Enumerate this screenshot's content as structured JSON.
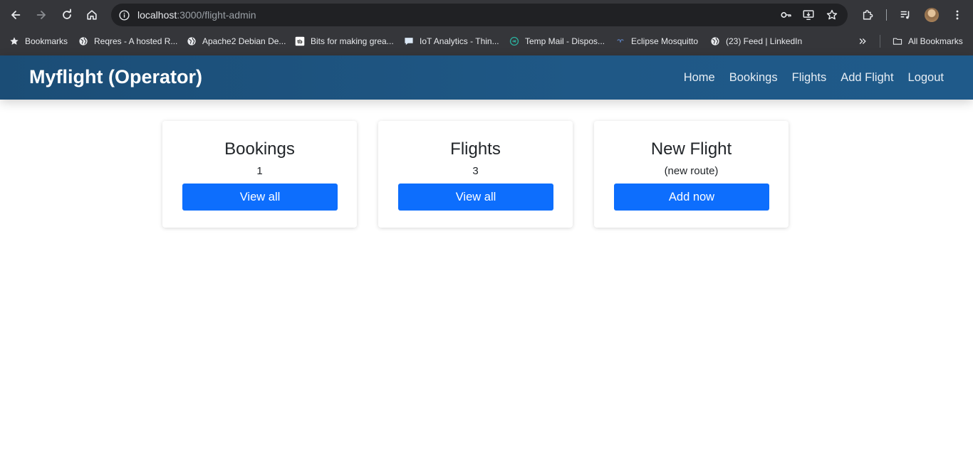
{
  "browser": {
    "url_host": "localhost",
    "url_path": ":3000/flight-admin",
    "bookmarks": [
      {
        "label": "Bookmarks",
        "icon": "star-icon"
      },
      {
        "label": "Reqres - A hosted R...",
        "icon": "globe-icon"
      },
      {
        "label": "Apache2 Debian De...",
        "icon": "globe-icon"
      },
      {
        "label": "Bits for making grea...",
        "icon": "bits-logo-icon"
      },
      {
        "label": "IoT Analytics - Thin...",
        "icon": "chat-icon"
      },
      {
        "label": "Temp Mail - Dispos...",
        "icon": "temp-mail-icon"
      },
      {
        "label": "Eclipse Mosquitto",
        "icon": "mosquitto-icon"
      },
      {
        "label": "(23) Feed | LinkedIn",
        "icon": "globe-icon"
      }
    ],
    "all_bookmarks_label": "All Bookmarks",
    "colors": {
      "chrome_bg": "#35363a",
      "omnibox_bg": "#202124"
    }
  },
  "app": {
    "brand": "Myflight (Operator)",
    "nav": [
      "Home",
      "Bookings",
      "Flights",
      "Add Flight",
      "Logout"
    ],
    "colors": {
      "navbar": "#1f5886",
      "button": "#0d6efd"
    }
  },
  "cards": [
    {
      "title": "Bookings",
      "value": "1",
      "button": "View all"
    },
    {
      "title": "Flights",
      "value": "3",
      "button": "View all"
    },
    {
      "title": "New Flight",
      "value": "(new route)",
      "button": "Add now"
    }
  ]
}
